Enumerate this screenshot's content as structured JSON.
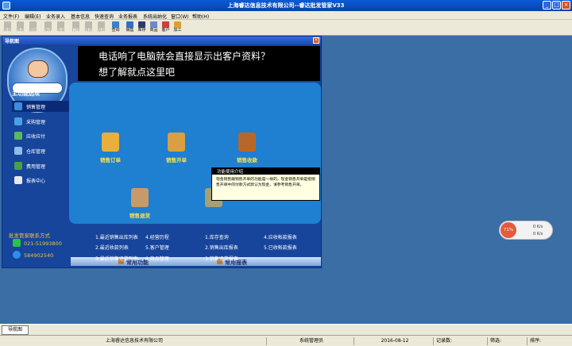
{
  "window": {
    "title": "上海睿达信息技术有限公司--睿达批发管家V33"
  },
  "menu": [
    "文件(F)",
    "编辑(E)",
    "业务录入",
    "基本信息",
    "快速查询",
    "业务报表",
    "系统出纳化",
    "窗口(W)",
    "帮助(H)"
  ],
  "toolbar": [
    "新增",
    "修改",
    "删除",
    "保存",
    "取消",
    "打印",
    "预览",
    "退出",
    "查询",
    "销售",
    "库存",
    "商品",
    "客户",
    "加工"
  ],
  "nav_window": {
    "title": "导航图"
  },
  "banner": {
    "line1": "电话响了电脑就会直接显示出客户资料？",
    "line2": "想了解就点这里吧"
  },
  "sidebar": {
    "heading": "主功能选项",
    "items": [
      {
        "label": "销售管理",
        "color": "#3b8fd8"
      },
      {
        "label": "采购管理",
        "color": "#4aa0e8"
      },
      {
        "label": "应收应付",
        "color": "#5cb85c"
      },
      {
        "label": "仓库管理",
        "color": "#8fbce8"
      },
      {
        "label": "费用管理",
        "color": "#49a04a"
      },
      {
        "label": "报表中心",
        "color": "#e8e8e8"
      }
    ]
  },
  "contact": {
    "title": "批发管家联系方式",
    "phone": "021-51993800",
    "qq": "584902540"
  },
  "functions": [
    {
      "label": "销售订单",
      "color": "#e8b03a"
    },
    {
      "label": "销售开单",
      "color": "#d8a040"
    },
    {
      "label": "销售收款",
      "color": "#b8672a"
    },
    {
      "label": "销售退货",
      "color": "#c89a6a"
    },
    {
      "label": "",
      "color": "#a8a070"
    }
  ],
  "tooltip": {
    "title": "功能使用介绍",
    "body": "现金销售跟销售开单的功能是一样的，现金销售开单是指销售开单中的付款方式默认为现金，请参考销售开单。"
  },
  "common": {
    "func_title": "常用功能",
    "report_title": "常用报表",
    "func_links": [
      "1.最近销售出库列表",
      "4.经营历程",
      "2.最近收款列表",
      "5.客户管理",
      "3.最近销售退货列表",
      "6.商品管理"
    ],
    "report_links": [
      "1.库存查询",
      "4.应收帐款报表",
      "2.销售出库报表",
      "5.已收帐款报表",
      "3.销售退货报表"
    ]
  },
  "gauge": {
    "percent": "71%",
    "row1": "0 K/s",
    "row2": "0 K/s"
  },
  "taskbar": {
    "tab": "导航图"
  },
  "status": {
    "company": "上海睿达信息技术有限公司",
    "user": "系统管理员",
    "date": "2016-08-12",
    "records": "记录数:",
    "filter": "筛选:",
    "sort": "排序:"
  }
}
